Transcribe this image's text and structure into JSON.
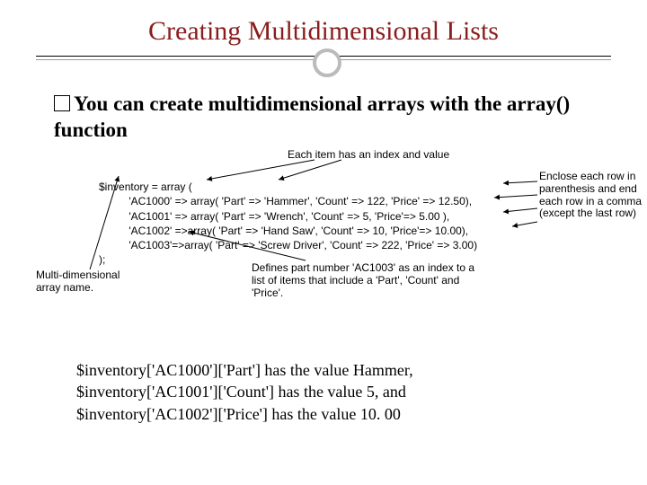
{
  "title": "Creating Multidimensional Lists",
  "bullet": "You can create multidimensional arrays with the array() function",
  "code": {
    "line1": "$inventory = array (",
    "line2": "          'AC1000' => array( 'Part' => 'Hammer', 'Count' => 122, 'Price' => 12.50),",
    "line3": "          'AC1001' => array( 'Part' => 'Wrench', 'Count' => 5, 'Price'=> 5.00 ),",
    "line4": "          'AC1002' =>array( 'Part' => 'Hand Saw', 'Count' => 10, 'Price'=> 10.00),",
    "line5": "          'AC1003'=>array( 'Part' => 'Screw Driver', 'Count' => 222, 'Price' => 3.00)",
    "line6": ");"
  },
  "anno": {
    "top": "Each item has an index and value",
    "right": "Enclose each row in parenthesis and end each row in a comma (except the last row)",
    "bottom": "Defines part number 'AC1003' as an index to a list of items that include a 'Part', 'Count' and 'Price'.",
    "left": "Multi-dimensional array name."
  },
  "examples": {
    "l1": "$inventory['AC1000']['Part'] has the value Hammer,",
    "l2": "$inventory['AC1001']['Count'] has the value 5, and",
    "l3": "$inventory['AC1002']['Price'] has the value 10. 00"
  }
}
